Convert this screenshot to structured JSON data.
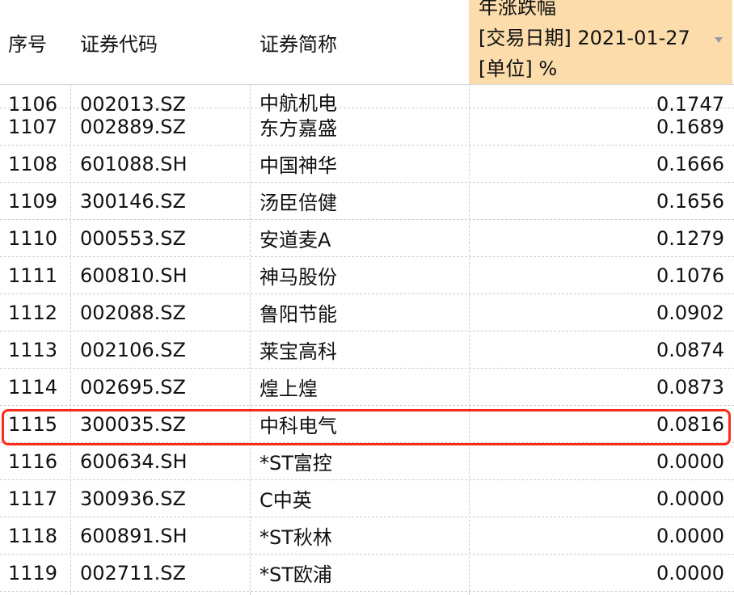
{
  "header": {
    "col_index": "序号",
    "col_code": "证券代码",
    "col_name": "证券简称",
    "col_metric_line1": "年涨跌幅",
    "col_metric_line2": "[交易日期] 2021-01-27",
    "col_metric_line3": "[单位] %",
    "sort_icon": "dropdown-triangle-icon"
  },
  "rows": [
    {
      "idx": "1106",
      "code": "002013.SZ",
      "name": "中航机电",
      "val": "0.1747"
    },
    {
      "idx": "1107",
      "code": "002889.SZ",
      "name": "东方嘉盛",
      "val": "0.1689"
    },
    {
      "idx": "1108",
      "code": "601088.SH",
      "name": "中国神华",
      "val": "0.1666"
    },
    {
      "idx": "1109",
      "code": "300146.SZ",
      "name": "汤臣倍健",
      "val": "0.1656"
    },
    {
      "idx": "1110",
      "code": "000553.SZ",
      "name": "安道麦A",
      "val": "0.1279"
    },
    {
      "idx": "1111",
      "code": "600810.SH",
      "name": "神马股份",
      "val": "0.1076"
    },
    {
      "idx": "1112",
      "code": "002088.SZ",
      "name": "鲁阳节能",
      "val": "0.0902"
    },
    {
      "idx": "1113",
      "code": "002106.SZ",
      "name": "莱宝高科",
      "val": "0.0874"
    },
    {
      "idx": "1114",
      "code": "002695.SZ",
      "name": "煌上煌",
      "val": "0.0873"
    },
    {
      "idx": "1115",
      "code": "300035.SZ",
      "name": "中科电气",
      "val": "0.0816"
    },
    {
      "idx": "1116",
      "code": "600634.SH",
      "name": "*ST富控",
      "val": "0.0000"
    },
    {
      "idx": "1117",
      "code": "300936.SZ",
      "name": "C中英",
      "val": "0.0000"
    },
    {
      "idx": "1118",
      "code": "600891.SH",
      "name": "*ST秋林",
      "val": "0.0000"
    },
    {
      "idx": "1119",
      "code": "002711.SZ",
      "name": "*ST欧浦",
      "val": "0.0000"
    }
  ],
  "highlighted_row": "1115",
  "colors": {
    "header_accent": "#fbdcaa",
    "highlight_border": "#ff2a1a"
  }
}
